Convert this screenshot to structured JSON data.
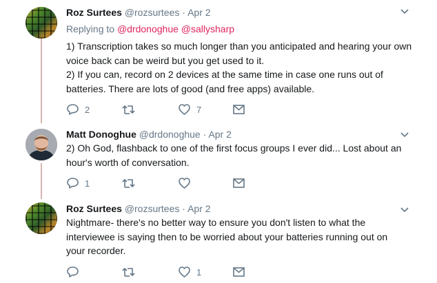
{
  "tweets": [
    {
      "name": "Roz Surtees",
      "handle": "@rozsurtees",
      "dot": "·",
      "date": "Apr 2",
      "replying_prefix": "Replying to",
      "replying_to": [
        "@drdonoghue",
        "@sallysharp"
      ],
      "lines": [
        "1) Transcription takes so much longer than you anticipated and hearing your own",
        "voice back can be weird but you get used to it.",
        "2) If you can, record on 2 devices at the same time in case one runs out of",
        "batteries. There are lots of good (and free apps) available."
      ],
      "reply_count": "2",
      "retweet_count": "",
      "like_count": "7"
    },
    {
      "name": "Matt Donoghue",
      "handle": "@drdonoghue",
      "dot": "·",
      "date": "Apr 2",
      "lines": [
        "2) Oh God, flashback to one of the first focus groups I ever did... Lost about an",
        "hour's worth of conversation."
      ],
      "reply_count": "1",
      "retweet_count": "",
      "like_count": ""
    },
    {
      "name": "Roz Surtees",
      "handle": "@rozsurtees",
      "dot": "·",
      "date": "Apr 2",
      "lines": [
        "Nightmare- there's no better way to ensure you don't listen to what the",
        "interviewee is saying then to be worried about your batteries running out on",
        "your recorder."
      ],
      "reply_count": "",
      "retweet_count": "",
      "like_count": "1"
    }
  ],
  "colors": {
    "mention": "#e0245e",
    "muted": "#657786",
    "thread_line": "#d6b4b0"
  },
  "icons": [
    "reply-icon",
    "retweet-icon",
    "like-icon",
    "message-icon",
    "chevron-down-icon"
  ]
}
